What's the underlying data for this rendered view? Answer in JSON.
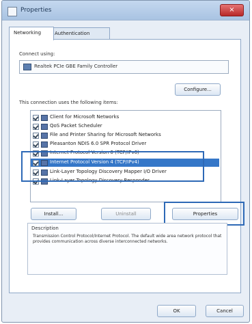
{
  "window": {
    "title": "Properties",
    "close_label": "×"
  },
  "tabs": [
    {
      "label": "Networking"
    },
    {
      "label": "Authentication"
    }
  ],
  "connect_using": {
    "label": "Connect using:",
    "adapter": "Realtek PCIe GBE Family Controller"
  },
  "buttons": {
    "configure": "Configure...",
    "install": "Install...",
    "uninstall": "Uninstall",
    "properties": "Properties",
    "ok": "OK",
    "cancel": "Cancel"
  },
  "items_label": "This connection uses the following items:",
  "items": [
    {
      "label": "Client for Microsoft Networks",
      "checked": true,
      "selected": false
    },
    {
      "label": "QoS Packet Scheduler",
      "checked": true,
      "selected": false
    },
    {
      "label": "File and Printer Sharing for Microsoft Networks",
      "checked": true,
      "selected": false
    },
    {
      "label": "Pleasanton NDIS 6.0 SPR Protocol Driver",
      "checked": true,
      "selected": false
    },
    {
      "label": "Internet Protocol Version 6 (TCP/IPv6)",
      "checked": true,
      "selected": false
    },
    {
      "label": "Internet Protocol Version 4 (TCP/IPv4)",
      "checked": true,
      "selected": true
    },
    {
      "label": "Link-Layer Topology Discovery Mapper I/O Driver",
      "checked": true,
      "selected": false
    },
    {
      "label": "Link-Layer Topology Discovery Responder",
      "checked": true,
      "selected": false
    }
  ],
  "description": {
    "label": "Description",
    "text": "Transmission Control Protocol/Internet Protocol. The default wide area network protocol that provides communication across diverse interconnected networks."
  },
  "colors": {
    "accent": "#2d69b6",
    "selection": "#3577c8"
  }
}
